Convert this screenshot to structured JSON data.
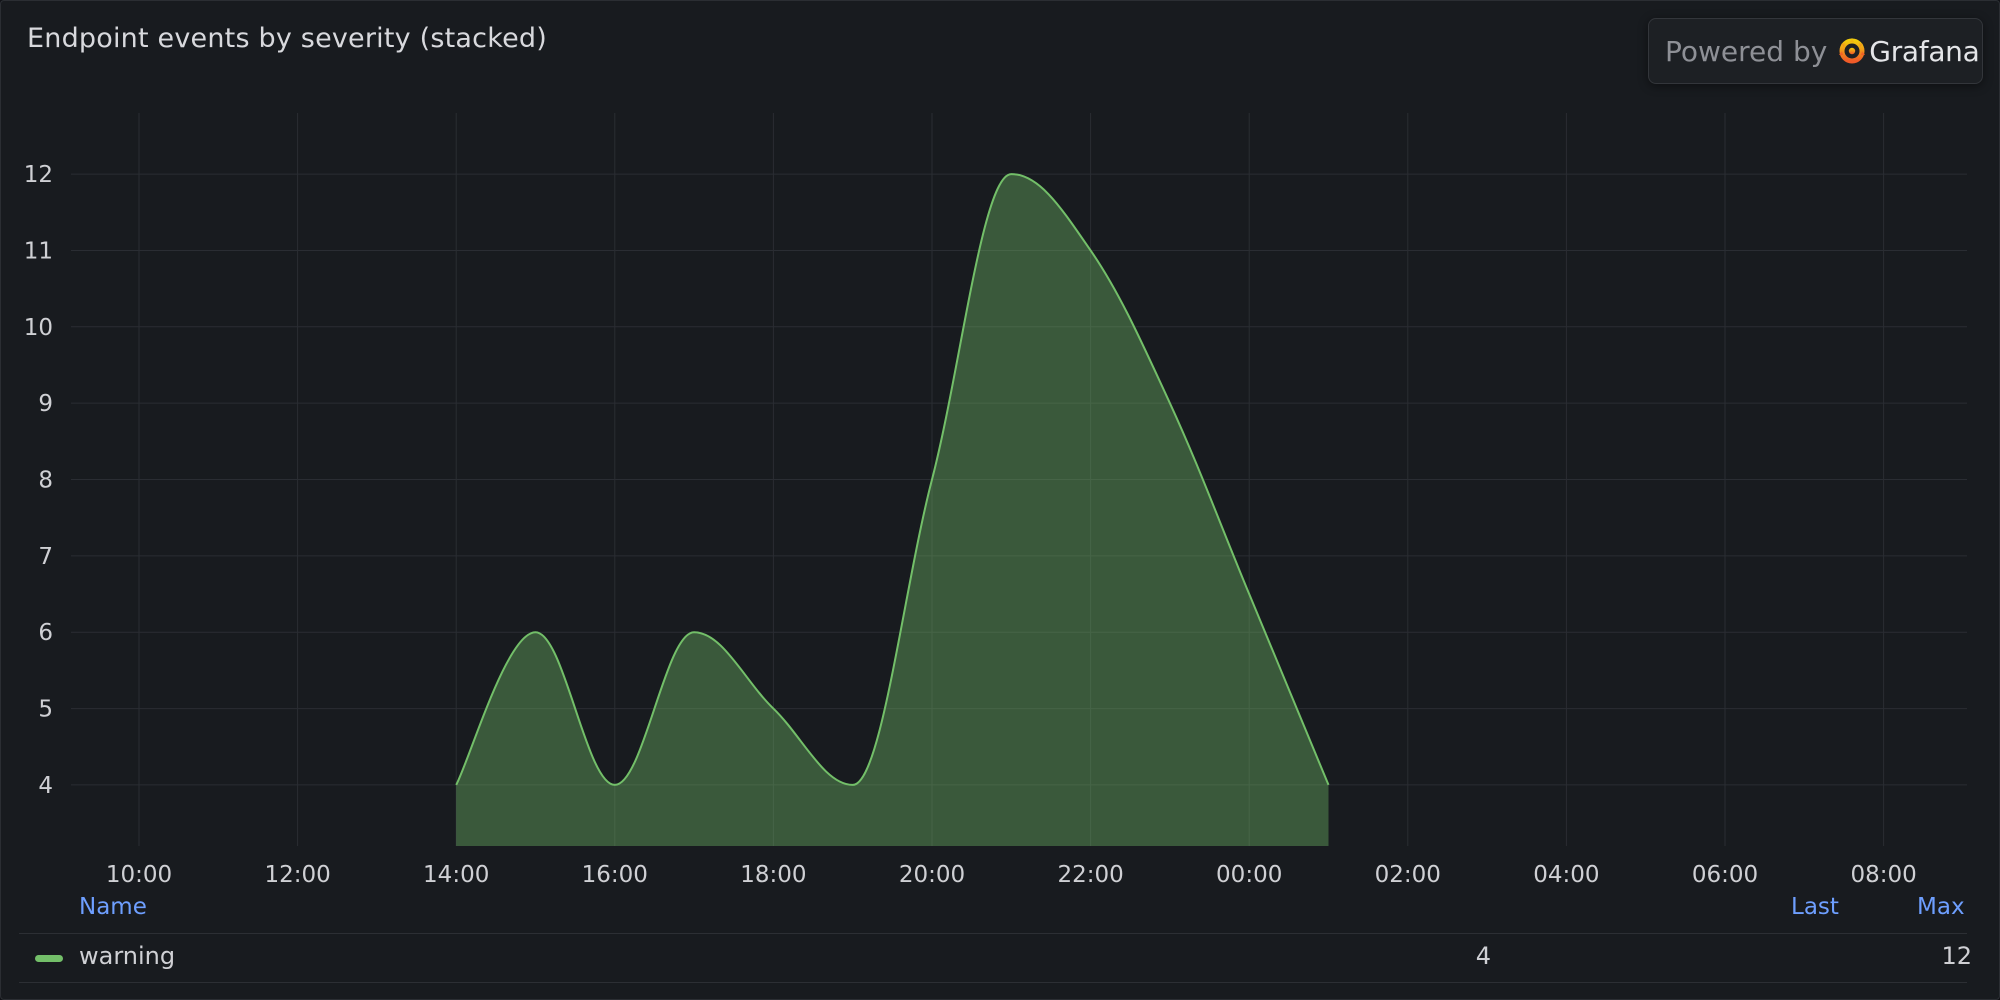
{
  "panel": {
    "title": "Endpoint events by severity (stacked)",
    "badge": {
      "powered_text": "Powered by",
      "brand": "Grafana"
    }
  },
  "chart_data": {
    "type": "area",
    "title": "Endpoint events by severity (stacked)",
    "stacked": true,
    "x_ticks": [
      "10:00",
      "12:00",
      "14:00",
      "16:00",
      "18:00",
      "20:00",
      "22:00",
      "00:00",
      "02:00",
      "04:00",
      "06:00",
      "08:00"
    ],
    "x": [
      "14:00",
      "15:00",
      "16:00",
      "17:00",
      "18:00",
      "19:00",
      "20:00",
      "21:00",
      "22:00",
      "23:00",
      "00:00",
      "01:00"
    ],
    "series": [
      {
        "name": "warning",
        "color": "#73bf69",
        "values": [
          4,
          6,
          4,
          6,
          5,
          4,
          8,
          12,
          11,
          9,
          6.5,
          4
        ]
      }
    ],
    "y_ticks": [
      4,
      5,
      6,
      7,
      8,
      9,
      10,
      11,
      12
    ],
    "ylim": [
      3.2,
      12.8
    ],
    "grid": true,
    "legend_placement": "bottom"
  },
  "legend": {
    "headers": {
      "name": "Name",
      "last": "Last",
      "max": "Max"
    },
    "rows": [
      {
        "name": "warning",
        "last": "4",
        "max": "12"
      }
    ]
  }
}
